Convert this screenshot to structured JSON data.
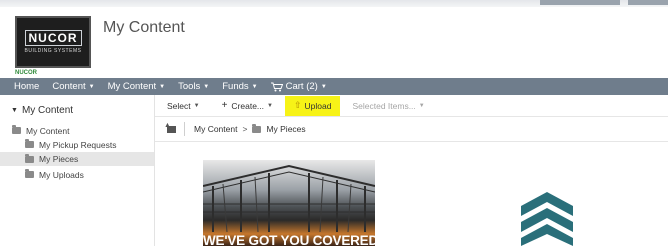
{
  "header": {
    "title": "My Content",
    "logo": {
      "wordmark": "NUCOR",
      "subtitle": "BUILDING SYSTEMS",
      "tag": "NUCOR"
    }
  },
  "nav": {
    "home": "Home",
    "content": "Content",
    "my_content": "My Content",
    "tools": "Tools",
    "funds": "Funds",
    "cart": "Cart (2)",
    "icons": {
      "cart": "cart-icon",
      "caret": "caret-down-icon"
    }
  },
  "sidebar": {
    "root_label": "My Content",
    "items": [
      {
        "label": "My Content",
        "selected": false
      },
      {
        "label": "My Pickup Requests",
        "selected": false
      },
      {
        "label": "My Pieces",
        "selected": true
      },
      {
        "label": "My Uploads",
        "selected": false
      }
    ]
  },
  "toolbar": {
    "select": "Select",
    "create": "Create...",
    "upload": "Upload",
    "selected_items": "Selected Items...",
    "upload_highlight_color": "#f7f317"
  },
  "breadcrumb": {
    "items": [
      "My Content",
      "My Pieces"
    ],
    "separator": ">"
  },
  "content": {
    "tile_caption": "WE'VE GOT YOU COVERED"
  },
  "colors": {
    "nav_bg": "#6f7d8c",
    "brand_teal": "#2a6f7a"
  }
}
